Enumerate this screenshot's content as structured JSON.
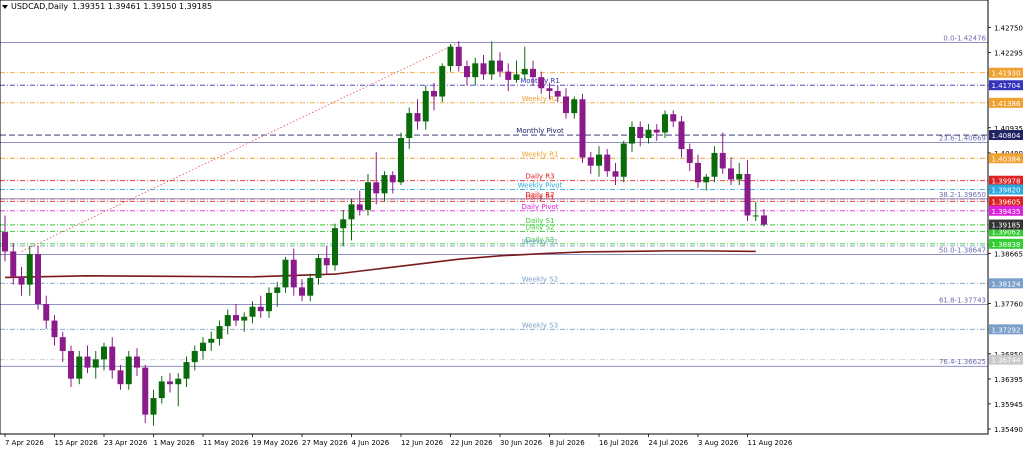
{
  "header": {
    "symbol_tf": "USDCAD,Daily",
    "quote": "1.39351 1.39461 1.39150 1.39185"
  },
  "chart_data": {
    "type": "candlestick",
    "symbol": "USDCAD",
    "timeframe": "Daily",
    "ylim": [
      1.354,
      1.431
    ],
    "y_ticks": [
      {
        "value": 1.4275,
        "label": "1.42750"
      },
      {
        "value": 1.42295,
        "label": "1.42295"
      },
      {
        "value": 1.40935,
        "label": "1.40935"
      },
      {
        "value": 1.4048,
        "label": "1.40480"
      },
      {
        "value": 1.38665,
        "label": "1.38665"
      },
      {
        "value": 1.3776,
        "label": "1.37760"
      },
      {
        "value": 1.3685,
        "label": "1.36850"
      },
      {
        "value": 1.36395,
        "label": "1.36395"
      },
      {
        "value": 1.35945,
        "label": "1.35945"
      },
      {
        "value": 1.3549,
        "label": "1.35490"
      }
    ],
    "x_ticks": [
      {
        "index": 0,
        "label": "7 Apr 2026"
      },
      {
        "index": 6,
        "label": "15 Apr 2026"
      },
      {
        "index": 12,
        "label": "23 Apr 2026"
      },
      {
        "index": 18,
        "label": "1 May 2026"
      },
      {
        "index": 24,
        "label": "11 May 2026"
      },
      {
        "index": 30,
        "label": "19 May 2026"
      },
      {
        "index": 36,
        "label": "27 May 2026"
      },
      {
        "index": 42,
        "label": "4 Jun 2026"
      },
      {
        "index": 48,
        "label": "12 Jun 2026"
      },
      {
        "index": 54,
        "label": "22 Jun 2026"
      },
      {
        "index": 60,
        "label": "30 Jun 2026"
      },
      {
        "index": 66,
        "label": "8 Jul 2026"
      },
      {
        "index": 72,
        "label": "16 Jul 2026"
      },
      {
        "index": 78,
        "label": "24 Jul 2026"
      },
      {
        "index": 84,
        "label": "3 Aug 2026"
      },
      {
        "index": 90,
        "label": "11 Aug 2026"
      }
    ],
    "candles": [
      [
        1.3905,
        1.3935,
        1.3852,
        1.387
      ],
      [
        1.387,
        1.3885,
        1.381,
        1.3825
      ],
      [
        1.3825,
        1.3842,
        1.379,
        1.381
      ],
      [
        1.381,
        1.388,
        1.379,
        1.3865
      ],
      [
        1.3865,
        1.388,
        1.3765,
        1.3775
      ],
      [
        1.3775,
        1.379,
        1.373,
        1.3745
      ],
      [
        1.3745,
        1.3755,
        1.37,
        1.3715
      ],
      [
        1.3715,
        1.3725,
        1.367,
        1.369
      ],
      [
        1.369,
        1.37,
        1.3625,
        1.364
      ],
      [
        1.364,
        1.369,
        1.363,
        1.368
      ],
      [
        1.368,
        1.37,
        1.365,
        1.366
      ],
      [
        1.366,
        1.369,
        1.364,
        1.3675
      ],
      [
        1.3675,
        1.3705,
        1.3655,
        1.3698
      ],
      [
        1.3698,
        1.3715,
        1.364,
        1.3655
      ],
      [
        1.3655,
        1.3665,
        1.362,
        1.363
      ],
      [
        1.363,
        1.369,
        1.362,
        1.368
      ],
      [
        1.368,
        1.3695,
        1.3645,
        1.366
      ],
      [
        1.366,
        1.3665,
        1.356,
        1.3575
      ],
      [
        1.3575,
        1.362,
        1.3555,
        1.3605
      ],
      [
        1.3605,
        1.3645,
        1.3595,
        1.3635
      ],
      [
        1.3635,
        1.365,
        1.3615,
        1.363
      ],
      [
        1.363,
        1.365,
        1.359,
        1.364
      ],
      [
        1.364,
        1.368,
        1.3625,
        1.367
      ],
      [
        1.367,
        1.37,
        1.3655,
        1.369
      ],
      [
        1.369,
        1.3715,
        1.3675,
        1.3705
      ],
      [
        1.3705,
        1.3725,
        1.369,
        1.3712
      ],
      [
        1.3712,
        1.3745,
        1.37,
        1.3735
      ],
      [
        1.3735,
        1.3765,
        1.372,
        1.3755
      ],
      [
        1.3755,
        1.3775,
        1.3735,
        1.3745
      ],
      [
        1.3745,
        1.376,
        1.3725,
        1.3752
      ],
      [
        1.3752,
        1.378,
        1.374,
        1.377
      ],
      [
        1.377,
        1.379,
        1.375,
        1.3762
      ],
      [
        1.3762,
        1.3805,
        1.375,
        1.3795
      ],
      [
        1.3795,
        1.3815,
        1.377,
        1.3805
      ],
      [
        1.3805,
        1.386,
        1.3795,
        1.3855
      ],
      [
        1.3855,
        1.3875,
        1.379,
        1.3805
      ],
      [
        1.3805,
        1.382,
        1.378,
        1.379
      ],
      [
        1.379,
        1.383,
        1.378,
        1.3822
      ],
      [
        1.3822,
        1.3865,
        1.381,
        1.3858
      ],
      [
        1.3858,
        1.388,
        1.383,
        1.3845
      ],
      [
        1.3845,
        1.392,
        1.3835,
        1.3912
      ],
      [
        1.3912,
        1.3945,
        1.388,
        1.3928
      ],
      [
        1.3928,
        1.3965,
        1.389,
        1.3955
      ],
      [
        1.3955,
        1.398,
        1.3935,
        1.3945
      ],
      [
        1.3945,
        1.401,
        1.3935,
        1.3995
      ],
      [
        1.3995,
        1.405,
        1.3955,
        1.3975
      ],
      [
        1.3975,
        1.4015,
        1.396,
        1.4008
      ],
      [
        1.4008,
        1.4015,
        1.3975,
        1.3995
      ],
      [
        1.3995,
        1.4085,
        1.399,
        1.4075
      ],
      [
        1.4075,
        1.413,
        1.4055,
        1.412
      ],
      [
        1.412,
        1.4145,
        1.409,
        1.4105
      ],
      [
        1.4105,
        1.417,
        1.409,
        1.416
      ],
      [
        1.416,
        1.4175,
        1.4125,
        1.415
      ],
      [
        1.415,
        1.421,
        1.414,
        1.4205
      ],
      [
        1.4205,
        1.4245,
        1.4195,
        1.424
      ],
      [
        1.424,
        1.425,
        1.4195,
        1.4205
      ],
      [
        1.4205,
        1.4215,
        1.417,
        1.4185
      ],
      [
        1.4185,
        1.422,
        1.417,
        1.421
      ],
      [
        1.421,
        1.4225,
        1.418,
        1.419
      ],
      [
        1.419,
        1.425,
        1.418,
        1.4215
      ],
      [
        1.4215,
        1.423,
        1.4185,
        1.4195
      ],
      [
        1.4195,
        1.421,
        1.416,
        1.418
      ],
      [
        1.418,
        1.4215,
        1.4175,
        1.419
      ],
      [
        1.419,
        1.424,
        1.418,
        1.42
      ],
      [
        1.42,
        1.4215,
        1.417,
        1.4185
      ],
      [
        1.4185,
        1.4195,
        1.4155,
        1.4165
      ],
      [
        1.4165,
        1.4175,
        1.4145,
        1.416
      ],
      [
        1.416,
        1.417,
        1.414,
        1.415
      ],
      [
        1.415,
        1.4165,
        1.411,
        1.412
      ],
      [
        1.412,
        1.415,
        1.411,
        1.4145
      ],
      [
        1.4145,
        1.4155,
        1.403,
        1.404
      ],
      [
        1.404,
        1.405,
        1.401,
        1.4025
      ],
      [
        1.4025,
        1.406,
        1.4005,
        1.4045
      ],
      [
        1.4045,
        1.4055,
        1.4005,
        1.4015
      ],
      [
        1.4015,
        1.403,
        1.399,
        1.4005
      ],
      [
        1.4005,
        1.407,
        1.3995,
        1.4065
      ],
      [
        1.4065,
        1.4105,
        1.405,
        1.4095
      ],
      [
        1.4095,
        1.4105,
        1.406,
        1.4075
      ],
      [
        1.4075,
        1.41,
        1.4065,
        1.409
      ],
      [
        1.409,
        1.41,
        1.407,
        1.4085
      ],
      [
        1.4085,
        1.4125,
        1.4075,
        1.4118
      ],
      [
        1.4118,
        1.4125,
        1.4095,
        1.4105
      ],
      [
        1.4105,
        1.4115,
        1.404,
        1.4055
      ],
      [
        1.4055,
        1.4065,
        1.4015,
        1.403
      ],
      [
        1.403,
        1.4045,
        1.3985,
        1.3995
      ],
      [
        1.3995,
        1.401,
        1.398,
        1.4005
      ],
      [
        1.4005,
        1.406,
        1.3995,
        1.4048
      ],
      [
        1.4048,
        1.4085,
        1.401,
        1.402
      ],
      [
        1.402,
        1.404,
        1.399,
        1.4
      ],
      [
        1.4,
        1.403,
        1.399,
        1.401
      ],
      [
        1.401,
        1.4035,
        1.3925,
        1.3935
      ],
      [
        1.3935,
        1.396,
        1.3925,
        1.3935
      ],
      [
        1.3935,
        1.3946,
        1.3915,
        1.39185
      ]
    ],
    "ma_points": [
      [
        0,
        1.3823
      ],
      [
        10,
        1.3826
      ],
      [
        20,
        1.3825
      ],
      [
        30,
        1.3824
      ],
      [
        40,
        1.3829
      ],
      [
        45,
        1.3838
      ],
      [
        50,
        1.3847
      ],
      [
        55,
        1.3856
      ],
      [
        60,
        1.3862
      ],
      [
        65,
        1.3866
      ],
      [
        70,
        1.3869
      ],
      [
        75,
        1.387
      ],
      [
        80,
        1.3871
      ],
      [
        85,
        1.3871
      ],
      [
        91,
        1.387
      ]
    ],
    "fib_anchor": {
      "start": [
        2,
        1.387
      ],
      "end": [
        55,
        1.42476
      ]
    },
    "levels": [
      {
        "value": 1.42476,
        "label": "0.0-1.42476",
        "label_pos": "right",
        "color": "#6b6bb3",
        "style": "solid",
        "badge": ""
      },
      {
        "value": 1.4193,
        "label": "",
        "label_pos": "",
        "color": "#f0a030",
        "style": "dashdot",
        "badge": "1.41930"
      },
      {
        "value": 1.41704,
        "label": "Monthly R1",
        "label_pos": "mid",
        "color": "#3333bb",
        "style": "dashdot",
        "badge": "1.41704"
      },
      {
        "value": 1.41386,
        "label": "Weekly R2",
        "label_pos": "mid",
        "color": "#f0a030",
        "style": "dashdot",
        "badge": "1.41386"
      },
      {
        "value": 1.40804,
        "label": "Monthly Pivot",
        "label_pos": "mid",
        "color": "#222266",
        "style": "dash",
        "badge": "1.40804"
      },
      {
        "value": 1.40669,
        "label": "23.6-1.40669",
        "label_pos": "right",
        "color": "#6b6bb3",
        "style": "solid",
        "badge": ""
      },
      {
        "value": 1.40384,
        "label": "Weekly R1",
        "label_pos": "mid",
        "color": "#f0a030",
        "style": "dashdot",
        "badge": "1.40384"
      },
      {
        "value": 1.39978,
        "label": "Daily R3",
        "label_pos": "mid",
        "color": "#dd2222",
        "style": "dashdot",
        "badge": "1.39978"
      },
      {
        "value": 1.3982,
        "label": "Weekly Pivot",
        "label_pos": "mid",
        "color": "#2aa8e0",
        "style": "dashdot",
        "badge": "1.39820"
      },
      {
        "value": 1.3965,
        "label": "Daily R2",
        "label_pos": "mid",
        "color": "#dd2222",
        "style": "dashdot",
        "badge": ""
      },
      {
        "value": 1.3965,
        "label": "38.2-1.39650",
        "label_pos": "right",
        "color": "#6b6bb3",
        "style": "solid",
        "badge": ""
      },
      {
        "value": 1.39605,
        "label": "Daily R1",
        "label_pos": "mid",
        "color": "#dd2222",
        "style": "dashdot",
        "badge": "1.39605"
      },
      {
        "value": 1.39435,
        "label": "Daily Pivot",
        "label_pos": "mid",
        "color": "#dd22dd",
        "style": "dashdot",
        "badge": "1.39435"
      },
      {
        "value": 1.3918,
        "label": "Daily S1",
        "label_pos": "mid",
        "color": "#33cc33",
        "style": "dashdot",
        "badge": ""
      },
      {
        "value": 1.39062,
        "label": "Daily S2",
        "label_pos": "mid",
        "color": "#33cc33",
        "style": "dashdot",
        "badge": "1.39062"
      },
      {
        "value": 1.38838,
        "label": "Daily S3",
        "label_pos": "mid",
        "color": "#33cc33",
        "style": "dashdot",
        "badge": "1.38838"
      },
      {
        "value": 1.388,
        "label": "Weekly S1",
        "label_pos": "mid",
        "color": "#7a9fc9",
        "style": "dashdot",
        "badge": ""
      },
      {
        "value": 1.38647,
        "label": "50.0-1.38647",
        "label_pos": "right",
        "color": "#6b6bb3",
        "style": "solid",
        "badge": ""
      },
      {
        "value": 1.38124,
        "label": "Weekly S2",
        "label_pos": "mid",
        "color": "#7a9fc9",
        "style": "dashdot",
        "badge": "1.38124"
      },
      {
        "value": 1.37743,
        "label": "61.8-1.37743",
        "label_pos": "right",
        "color": "#6b6bb3",
        "style": "solid",
        "badge": ""
      },
      {
        "value": 1.37292,
        "label": "Weekly S3",
        "label_pos": "mid",
        "color": "#7a9fc9",
        "style": "dashdot",
        "badge": "1.37292"
      },
      {
        "value": 1.36744,
        "label": "",
        "label_pos": "",
        "color": "#c8c8c8",
        "style": "dashdot",
        "badge": "1.36744"
      },
      {
        "value": 1.36625,
        "label": "76.4-1.36625",
        "label_pos": "right",
        "color": "#6b6bb3",
        "style": "solid",
        "badge": ""
      }
    ],
    "current_price": {
      "value": 1.39185,
      "label": "1.39185"
    },
    "colors": {
      "bull": "#0a6b0a",
      "bear": "#8b1a8b",
      "ma": "#7a1a1a",
      "fib_line": "#e05050",
      "current_price_badge": "#333333"
    }
  }
}
